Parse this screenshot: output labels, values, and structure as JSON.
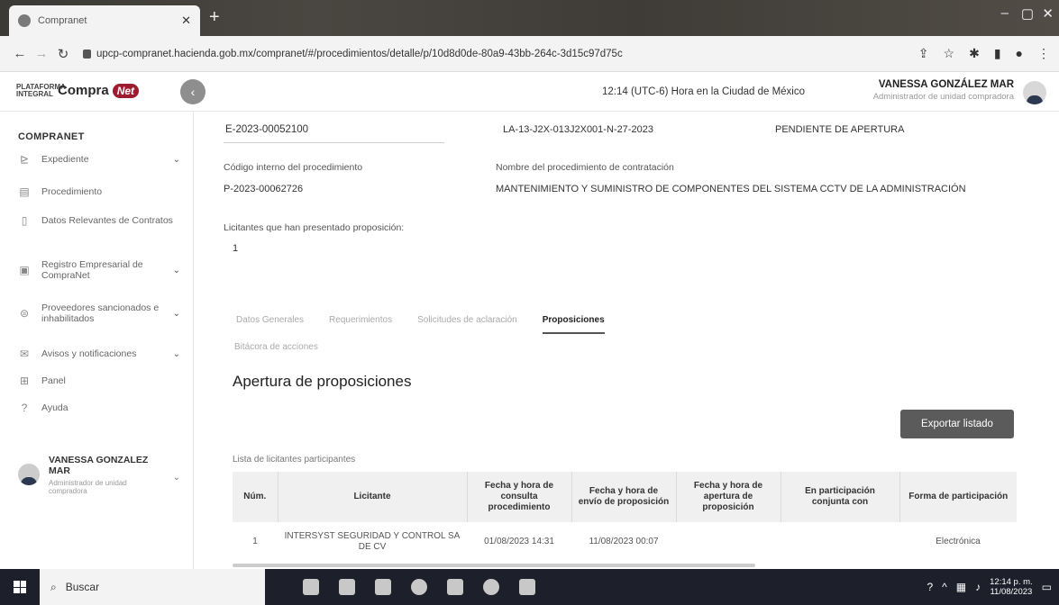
{
  "browser": {
    "tab_title": "Compranet",
    "url": "upcp-compranet.hacienda.gob.mx/compranet/#/procedimientos/detalle/p/10d8d0de-80a9-43bb-264c-3d15c97d75c"
  },
  "header": {
    "logo_plataforma": "PLATAFORMA INTEGRAL",
    "logo_compra": "Compra",
    "logo_net": "Net",
    "clock": "12:14 (UTC-6) Hora en la Ciudad de México",
    "user_name": "VANESSA GONZÁLEZ MAR",
    "user_role": "Administrador de unidad compradora"
  },
  "sidebar": {
    "title": "COMPRANET",
    "items": [
      {
        "label": "Expediente",
        "icon": "folder-icon",
        "chevron": "⌄"
      },
      {
        "label": "Procedimiento",
        "icon": "document-icon",
        "chevron": ""
      },
      {
        "label": "Datos Relevantes de Contratos",
        "icon": "contract-icon",
        "chevron": ""
      },
      {
        "label": "Registro Empresarial de CompraNet",
        "icon": "registry-icon",
        "chevron": "⌄"
      },
      {
        "label": "Proveedores sancionados e inhabilitados",
        "icon": "sanction-icon",
        "chevron": "⌄"
      },
      {
        "label": "Avisos y notificaciones",
        "icon": "mail-icon",
        "chevron": "⌄"
      },
      {
        "label": "Panel",
        "icon": "panel-icon",
        "chevron": ""
      },
      {
        "label": "Ayuda",
        "icon": "help-icon",
        "chevron": ""
      }
    ],
    "user_name": "VANESSA GONZALEZ MAR",
    "user_role": "Administrador de unidad compradora"
  },
  "main": {
    "expediente": "E-2023-00052100",
    "procedimiento_num": "LA-13-J2X-013J2X001-N-27-2023",
    "status": "PENDIENTE DE APERTURA",
    "codigo_label": "Código interno del procedimiento",
    "codigo_value": "P-2023-00062726",
    "nombre_label": "Nombre del procedimiento de contratación",
    "nombre_value": "MANTENIMIENTO Y SUMINISTRO DE COMPONENTES DEL SISTEMA CCTV DE LA ADMINISTRACIÓN",
    "licitantes_label": "Licitantes que han presentado proposición:",
    "licitantes_value": "1",
    "tabs": [
      "Datos Generales",
      "Requerimientos",
      "Solicitudes de aclaración",
      "Proposiciones"
    ],
    "bitacora": "Bitácora de acciones",
    "section_title": "Apertura de proposiciones",
    "export_label": "Exportar listado",
    "list_label": "Lista de licitantes participantes",
    "table": {
      "headers": [
        "Núm.",
        "Licitante",
        "Fecha y hora de consulta procedimiento",
        "Fecha y hora de envío de proposición",
        "Fecha y hora de apertura de proposición",
        "En participación conjunta con",
        "Forma de participación"
      ],
      "rows": [
        [
          "1",
          "INTERSYST SEGURIDAD Y CONTROL SA DE CV",
          "01/08/2023 14:31",
          "11/08/2023 00:07",
          "",
          "",
          "Electrónica"
        ]
      ]
    }
  },
  "taskbar": {
    "search": "Buscar",
    "time": "12:14 p. m.",
    "date": "11/08/2023"
  }
}
